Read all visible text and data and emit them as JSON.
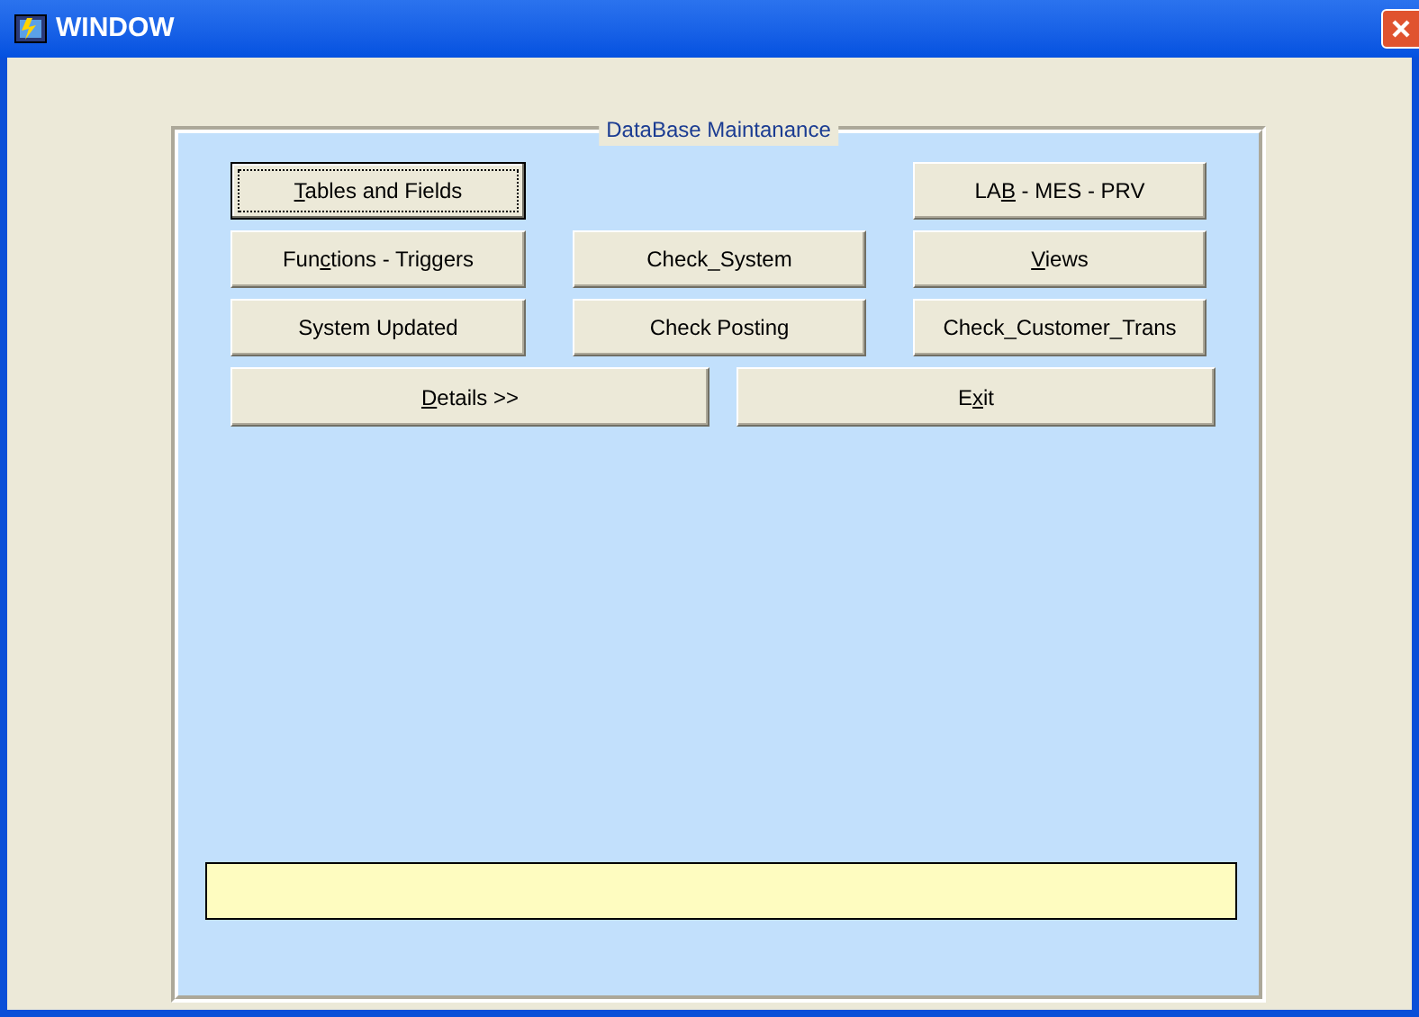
{
  "window": {
    "title": "WINDOW"
  },
  "group": {
    "title": "DataBase Maintanance"
  },
  "button_rows": [
    [
      {
        "kind": "button",
        "key": "T",
        "after": "ables and Fields",
        "focused": true
      },
      {
        "kind": "spacer"
      },
      {
        "kind": "button",
        "before": "LA",
        "key": "B",
        "after": " - MES - PRV",
        "focused": false
      }
    ],
    [
      {
        "kind": "button",
        "before": "Fun",
        "key": "c",
        "after": "tions - Triggers",
        "focused": false
      },
      {
        "kind": "button",
        "before": "Check_System",
        "focused": false
      },
      {
        "kind": "button",
        "key": "V",
        "after": "iews",
        "focused": false
      }
    ],
    [
      {
        "kind": "button",
        "before": "System Updated",
        "focused": false
      },
      {
        "kind": "button",
        "before": "Check Posting",
        "focused": false
      },
      {
        "kind": "button",
        "before": "Check_Customer_Trans",
        "focused": false
      }
    ]
  ],
  "wide_buttons": [
    {
      "key": "D",
      "after": "etails >>",
      "focused": false
    },
    {
      "before": "E",
      "key": "x",
      "after": "it",
      "focused": false
    }
  ]
}
